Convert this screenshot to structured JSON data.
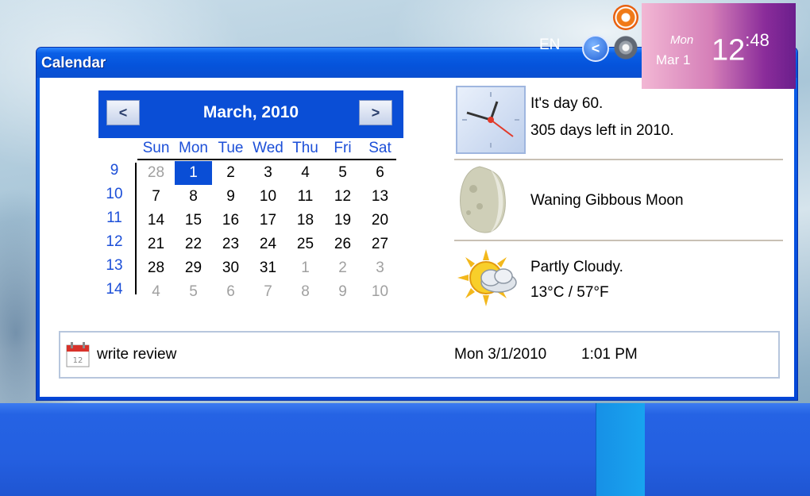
{
  "window": {
    "title": "Calendar"
  },
  "calendar": {
    "month_title": "March, 2010",
    "prev_label": "<",
    "next_label": ">",
    "weekdays": [
      "Sun",
      "Mon",
      "Tue",
      "Wed",
      "Thu",
      "Fri",
      "Sat"
    ],
    "week_numbers": [
      "9",
      "10",
      "11",
      "12",
      "13",
      "14"
    ],
    "weeks": [
      [
        "28",
        "1",
        "2",
        "3",
        "4",
        "5",
        "6"
      ],
      [
        "7",
        "8",
        "9",
        "10",
        "11",
        "12",
        "13"
      ],
      [
        "14",
        "15",
        "16",
        "17",
        "18",
        "19",
        "20"
      ],
      [
        "21",
        "22",
        "23",
        "24",
        "25",
        "26",
        "27"
      ],
      [
        "28",
        "29",
        "30",
        "31",
        "1",
        "2",
        "3"
      ],
      [
        "4",
        "5",
        "6",
        "7",
        "8",
        "9",
        "10"
      ]
    ],
    "selected_day": "1"
  },
  "info": {
    "day_line1": "It's day 60.",
    "day_line2": "305 days left in 2010.",
    "moon_phase": "Waning Gibbous Moon",
    "weather_line1": "Partly Cloudy.",
    "weather_line2": "13°C / 57°F"
  },
  "status": {
    "note": "write review",
    "date": "Mon 3/1/2010",
    "time": "1:01 PM"
  },
  "taskbar": {
    "language": "EN",
    "tray_arrow": "<",
    "clock_day": "Mon",
    "clock_date": "Mar 1",
    "clock_hour_min": "12",
    "clock_sec": ":48"
  },
  "colors": {
    "title_bar": "#0a5fe6",
    "calendar_header": "#0a4ed6",
    "weekday_text": "#1c4fd8",
    "muted_day": "#a0a0a0",
    "clock_panel_start": "#f2b7d4",
    "clock_panel_end": "#6b1e8c"
  }
}
